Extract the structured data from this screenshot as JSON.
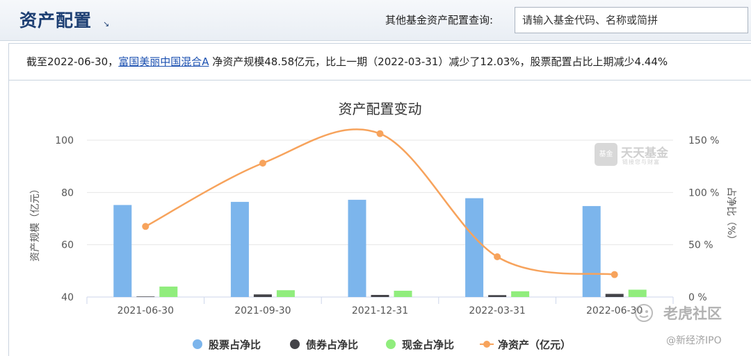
{
  "header": {
    "title": "资产配置",
    "query_label": "其他基金资产配置查询:",
    "search_placeholder": "请输入基金代码、名称或简拼"
  },
  "summary": {
    "prefix": "截至2022-06-30，",
    "fund_name": "富国美丽中国混合A",
    "suffix": " 净资产规模48.58亿元，比上一期（2022-03-31）减少了12.03%，股票配置占比上期减少4.44%"
  },
  "chart_data": {
    "type": "bar",
    "title": "资产配置变动",
    "categories": [
      "2021-06-30",
      "2021-09-30",
      "2021-12-31",
      "2022-03-31",
      "2022-06-30"
    ],
    "series": [
      {
        "name": "股票占净比",
        "type": "bar",
        "axis": "right",
        "color": "#7cb5ec",
        "values": [
          88,
          91,
          93,
          94.5,
          87
        ]
      },
      {
        "name": "债券占净比",
        "type": "bar",
        "axis": "right",
        "color": "#434348",
        "values": [
          0.5,
          2.5,
          2,
          1.8,
          3
        ]
      },
      {
        "name": "现金占净比",
        "type": "bar",
        "axis": "right",
        "color": "#90ed7d",
        "values": [
          10,
          6.5,
          6,
          5.5,
          7
        ]
      },
      {
        "name": "净资产（亿元）",
        "type": "line",
        "axis": "left",
        "color": "#f7a35c",
        "values": [
          67,
          91.2,
          102.5,
          55.4,
          48.58
        ]
      }
    ],
    "ylabel": "资产规模（亿元）",
    "ylim": [
      40,
      100
    ],
    "yticks": [
      "40",
      "60",
      "80",
      "100"
    ],
    "ylabel_right": "占净比（%）",
    "ylim_right": [
      0,
      150
    ],
    "yticks_right": [
      "0 %",
      "50 %",
      "100 %",
      "150 %"
    ],
    "grid": true,
    "legend": "bottom"
  },
  "watermarks": {
    "tiantian_name": "天天基金",
    "tiantian_icon": "基金",
    "tiantian_sub": "链接您与财富",
    "tiger": "老虎社区",
    "author": "@新经济IPO"
  },
  "colors": {
    "title": "#1d3f73",
    "link": "#1a4fb0",
    "grid": "#e6e6e6"
  }
}
